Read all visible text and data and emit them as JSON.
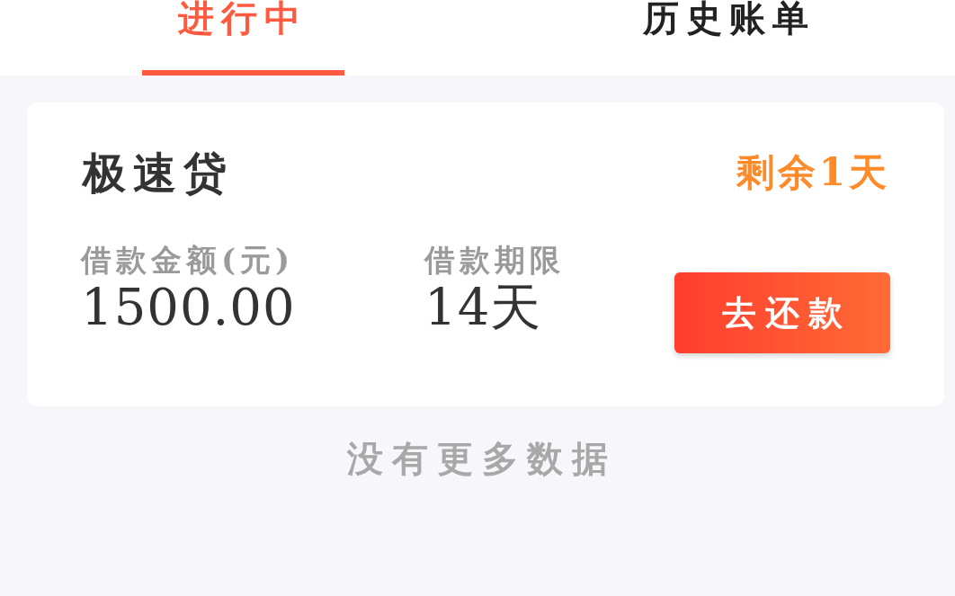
{
  "tabs": [
    {
      "label": "进行中",
      "selected": true
    },
    {
      "label": "历史账单",
      "selected": false
    }
  ],
  "loans": [
    {
      "product": "极速贷",
      "remaining": "剩余1天",
      "fields": [
        {
          "label": "借款金额(元)",
          "value": "1500.00"
        },
        {
          "label": "借款期限",
          "value": "14天"
        }
      ],
      "action": "去还款"
    }
  ],
  "footer_note": "没有更多数据"
}
